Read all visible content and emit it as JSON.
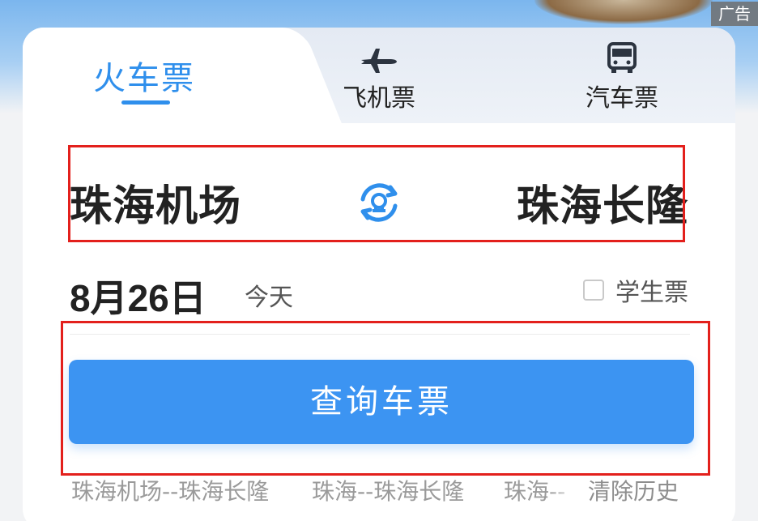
{
  "ad_badge": "广告",
  "tabs": [
    {
      "label": "火车票",
      "icon": "train-icon",
      "active": true
    },
    {
      "label": "飞机票",
      "icon": "airplane-icon",
      "active": false
    },
    {
      "label": "汽车票",
      "icon": "bus-icon",
      "active": false
    }
  ],
  "route": {
    "from": "珠海机场",
    "to": "珠海长隆",
    "swap_icon": "railway-swap-icon"
  },
  "date": {
    "value": "8月26日",
    "sub": "今天"
  },
  "student_ticket": {
    "label": "学生票",
    "checked": false
  },
  "search_button": "查询车票",
  "history": {
    "items": [
      "珠海机场--珠海长隆",
      "珠海--珠海长隆",
      "珠海--"
    ],
    "clear": "清除历史"
  },
  "colors": {
    "accent": "#2f8fec",
    "button": "#3c94f2",
    "highlight_frame": "#e3201c"
  }
}
